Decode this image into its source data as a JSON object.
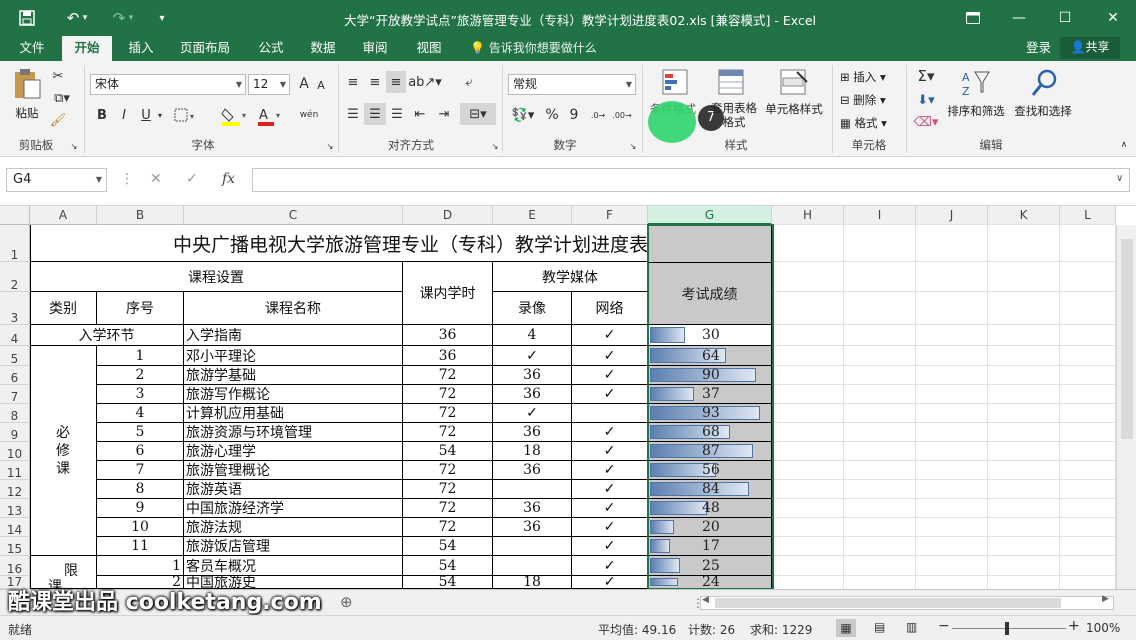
{
  "titlebar": {
    "title": "大学“开放教学试点”旅游管理专业（专科）教学计划进度表02.xls  [兼容模式] - Excel",
    "qa_dropdown": "▾"
  },
  "tabs": [
    {
      "label": "文件"
    },
    {
      "label": "开始",
      "active": true
    },
    {
      "label": "插入"
    },
    {
      "label": "页面布局"
    },
    {
      "label": "公式"
    },
    {
      "label": "数据"
    },
    {
      "label": "审阅"
    },
    {
      "label": "视图"
    }
  ],
  "tellme": "告诉我你想要做什么",
  "account": {
    "login": "登录",
    "share": "共享"
  },
  "ribbon": {
    "clipboard": {
      "paste": "粘贴",
      "label": "剪贴板"
    },
    "font": {
      "name": "宋体",
      "size": "12",
      "label": "字体",
      "bold": "B",
      "italic": "I",
      "underline": "U",
      "grow": "A",
      "shrink": "A",
      "phonetic": "wén"
    },
    "alignment": {
      "label": "对齐方式"
    },
    "number": {
      "format": "常规",
      "percent": "%",
      "comma": "9",
      "label": "数字"
    },
    "styles": {
      "conditional": "条件格式",
      "table": "套用表格格式",
      "cell": "单元格样式",
      "label": "样式",
      "badge": "7"
    },
    "cells": {
      "insert": "插入",
      "delete": "删除",
      "format": "格式",
      "label": "单元格"
    },
    "editing": {
      "sum": "Σ",
      "sort": "排序和筛选",
      "find": "查找和选择",
      "label": "编辑"
    }
  },
  "formula_bar": {
    "namebox": "G4",
    "fx": "fx",
    "value": ""
  },
  "columns": [
    "A",
    "B",
    "C",
    "D",
    "E",
    "F",
    "G",
    "H",
    "I",
    "J",
    "K",
    "L"
  ],
  "rows": [
    "1",
    "2",
    "3",
    "4",
    "5",
    "6",
    "7",
    "8",
    "9",
    "10",
    "11",
    "12",
    "13",
    "14",
    "15",
    "16",
    "17"
  ],
  "sheet": {
    "title": "中央广播电视大学旅游管理专业（专科）教学计划进度表",
    "h_course_setup": "课程设置",
    "h_hours": "课内学时",
    "h_media": "教学媒体",
    "h_score": "考试成绩",
    "h_category": "类别",
    "h_seq": "序号",
    "h_course_name": "课程名称",
    "h_video": "录像",
    "h_network": "网络",
    "cat_entry": "入学环节",
    "cat_required": "必修课",
    "cat_elective1": "限",
    "cat_elective2": "课",
    "records": [
      {
        "seq": "",
        "name": "入学指南",
        "hours": "36",
        "video": "4",
        "net": "✓",
        "score": "30"
      },
      {
        "seq": "1",
        "name": "邓小平理论",
        "hours": "36",
        "video": "✓",
        "net": "✓",
        "score": "64"
      },
      {
        "seq": "2",
        "name": "旅游学基础",
        "hours": "72",
        "video": "36",
        "net": "✓",
        "score": "90"
      },
      {
        "seq": "3",
        "name": "旅游写作概论",
        "hours": "72",
        "video": "36",
        "net": "✓",
        "score": "37"
      },
      {
        "seq": "4",
        "name": "计算机应用基础",
        "hours": "72",
        "video": "✓",
        "net": "",
        "score": "93"
      },
      {
        "seq": "5",
        "name": "旅游资源与环境管理",
        "hours": "72",
        "video": "36",
        "net": "✓",
        "score": "68"
      },
      {
        "seq": "6",
        "name": "旅游心理学",
        "hours": "54",
        "video": "18",
        "net": "✓",
        "score": "87"
      },
      {
        "seq": "7",
        "name": "旅游管理概论",
        "hours": "72",
        "video": "36",
        "net": "✓",
        "score": "56"
      },
      {
        "seq": "8",
        "name": "旅游英语",
        "hours": "72",
        "video": "",
        "net": "✓",
        "score": "84"
      },
      {
        "seq": "9",
        "name": "中国旅游经济学",
        "hours": "72",
        "video": "36",
        "net": "✓",
        "score": "48"
      },
      {
        "seq": "10",
        "name": "旅游法规",
        "hours": "72",
        "video": "36",
        "net": "✓",
        "score": "20"
      },
      {
        "seq": "11",
        "name": "旅游饭店管理",
        "hours": "54",
        "video": "",
        "net": "✓",
        "score": "17"
      },
      {
        "seq": "1",
        "name": "客员车概况",
        "hours": "54",
        "video": "",
        "net": "✓",
        "score": "25"
      },
      {
        "seq": "2",
        "name": "中国旅游史",
        "hours": "54",
        "video": "18",
        "net": "✓",
        "score": "24"
      }
    ],
    "bar_fractions": [
      0.3,
      0.64,
      0.9,
      0.37,
      0.93,
      0.68,
      0.87,
      0.56,
      0.84,
      0.48,
      0.2,
      0.17,
      0.25,
      0.24
    ]
  },
  "sheetbar": {
    "watermark": "酷课堂出品 coolketang.com",
    "add": "⊕"
  },
  "statusbar": {
    "ready": "就绪",
    "average": "平均值: 49.16",
    "count": "计数: 26",
    "sum": "求和: 1229",
    "zoom": "100%"
  }
}
